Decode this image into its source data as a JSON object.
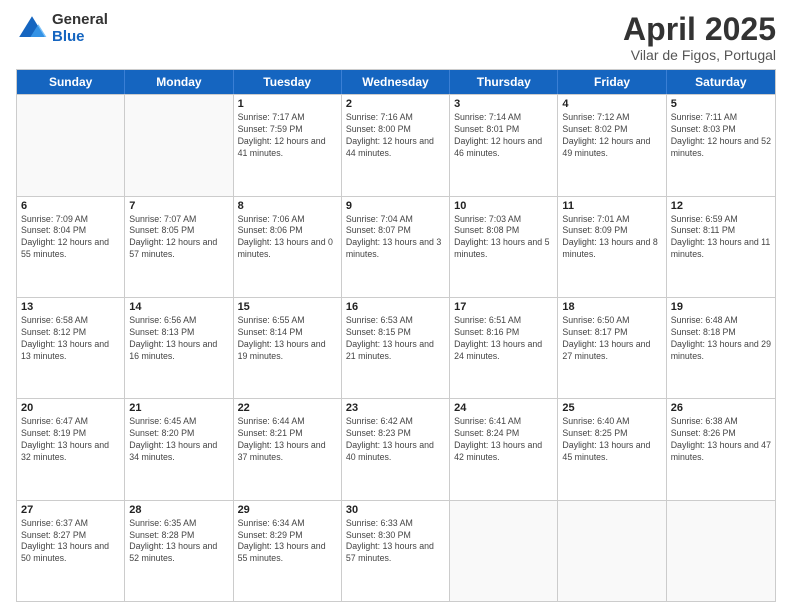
{
  "logo": {
    "general": "General",
    "blue": "Blue"
  },
  "title": "April 2025",
  "subtitle": "Vilar de Figos, Portugal",
  "headers": [
    "Sunday",
    "Monday",
    "Tuesday",
    "Wednesday",
    "Thursday",
    "Friday",
    "Saturday"
  ],
  "weeks": [
    [
      {
        "day": "",
        "info": ""
      },
      {
        "day": "",
        "info": ""
      },
      {
        "day": "1",
        "info": "Sunrise: 7:17 AM\nSunset: 7:59 PM\nDaylight: 12 hours and 41 minutes."
      },
      {
        "day": "2",
        "info": "Sunrise: 7:16 AM\nSunset: 8:00 PM\nDaylight: 12 hours and 44 minutes."
      },
      {
        "day": "3",
        "info": "Sunrise: 7:14 AM\nSunset: 8:01 PM\nDaylight: 12 hours and 46 minutes."
      },
      {
        "day": "4",
        "info": "Sunrise: 7:12 AM\nSunset: 8:02 PM\nDaylight: 12 hours and 49 minutes."
      },
      {
        "day": "5",
        "info": "Sunrise: 7:11 AM\nSunset: 8:03 PM\nDaylight: 12 hours and 52 minutes."
      }
    ],
    [
      {
        "day": "6",
        "info": "Sunrise: 7:09 AM\nSunset: 8:04 PM\nDaylight: 12 hours and 55 minutes."
      },
      {
        "day": "7",
        "info": "Sunrise: 7:07 AM\nSunset: 8:05 PM\nDaylight: 12 hours and 57 minutes."
      },
      {
        "day": "8",
        "info": "Sunrise: 7:06 AM\nSunset: 8:06 PM\nDaylight: 13 hours and 0 minutes."
      },
      {
        "day": "9",
        "info": "Sunrise: 7:04 AM\nSunset: 8:07 PM\nDaylight: 13 hours and 3 minutes."
      },
      {
        "day": "10",
        "info": "Sunrise: 7:03 AM\nSunset: 8:08 PM\nDaylight: 13 hours and 5 minutes."
      },
      {
        "day": "11",
        "info": "Sunrise: 7:01 AM\nSunset: 8:09 PM\nDaylight: 13 hours and 8 minutes."
      },
      {
        "day": "12",
        "info": "Sunrise: 6:59 AM\nSunset: 8:11 PM\nDaylight: 13 hours and 11 minutes."
      }
    ],
    [
      {
        "day": "13",
        "info": "Sunrise: 6:58 AM\nSunset: 8:12 PM\nDaylight: 13 hours and 13 minutes."
      },
      {
        "day": "14",
        "info": "Sunrise: 6:56 AM\nSunset: 8:13 PM\nDaylight: 13 hours and 16 minutes."
      },
      {
        "day": "15",
        "info": "Sunrise: 6:55 AM\nSunset: 8:14 PM\nDaylight: 13 hours and 19 minutes."
      },
      {
        "day": "16",
        "info": "Sunrise: 6:53 AM\nSunset: 8:15 PM\nDaylight: 13 hours and 21 minutes."
      },
      {
        "day": "17",
        "info": "Sunrise: 6:51 AM\nSunset: 8:16 PM\nDaylight: 13 hours and 24 minutes."
      },
      {
        "day": "18",
        "info": "Sunrise: 6:50 AM\nSunset: 8:17 PM\nDaylight: 13 hours and 27 minutes."
      },
      {
        "day": "19",
        "info": "Sunrise: 6:48 AM\nSunset: 8:18 PM\nDaylight: 13 hours and 29 minutes."
      }
    ],
    [
      {
        "day": "20",
        "info": "Sunrise: 6:47 AM\nSunset: 8:19 PM\nDaylight: 13 hours and 32 minutes."
      },
      {
        "day": "21",
        "info": "Sunrise: 6:45 AM\nSunset: 8:20 PM\nDaylight: 13 hours and 34 minutes."
      },
      {
        "day": "22",
        "info": "Sunrise: 6:44 AM\nSunset: 8:21 PM\nDaylight: 13 hours and 37 minutes."
      },
      {
        "day": "23",
        "info": "Sunrise: 6:42 AM\nSunset: 8:23 PM\nDaylight: 13 hours and 40 minutes."
      },
      {
        "day": "24",
        "info": "Sunrise: 6:41 AM\nSunset: 8:24 PM\nDaylight: 13 hours and 42 minutes."
      },
      {
        "day": "25",
        "info": "Sunrise: 6:40 AM\nSunset: 8:25 PM\nDaylight: 13 hours and 45 minutes."
      },
      {
        "day": "26",
        "info": "Sunrise: 6:38 AM\nSunset: 8:26 PM\nDaylight: 13 hours and 47 minutes."
      }
    ],
    [
      {
        "day": "27",
        "info": "Sunrise: 6:37 AM\nSunset: 8:27 PM\nDaylight: 13 hours and 50 minutes."
      },
      {
        "day": "28",
        "info": "Sunrise: 6:35 AM\nSunset: 8:28 PM\nDaylight: 13 hours and 52 minutes."
      },
      {
        "day": "29",
        "info": "Sunrise: 6:34 AM\nSunset: 8:29 PM\nDaylight: 13 hours and 55 minutes."
      },
      {
        "day": "30",
        "info": "Sunrise: 6:33 AM\nSunset: 8:30 PM\nDaylight: 13 hours and 57 minutes."
      },
      {
        "day": "",
        "info": ""
      },
      {
        "day": "",
        "info": ""
      },
      {
        "day": "",
        "info": ""
      }
    ]
  ]
}
